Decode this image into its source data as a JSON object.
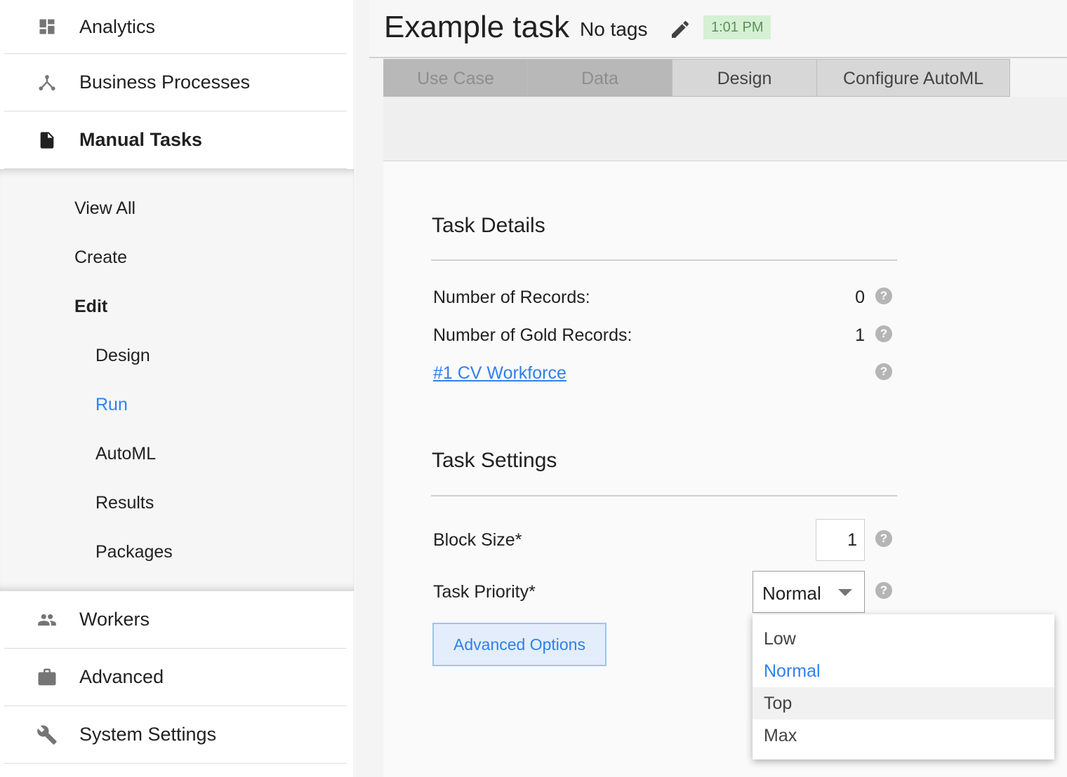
{
  "sidebar": {
    "items_top": [
      {
        "label": "Analytics",
        "icon": "dashboard-icon"
      },
      {
        "label": "Business Processes",
        "icon": "process-icon"
      },
      {
        "label": "Manual Tasks",
        "icon": "document-icon",
        "active": true
      }
    ],
    "sub_items": [
      {
        "label": "View All"
      },
      {
        "label": "Create"
      },
      {
        "label": "Edit",
        "bold": true
      },
      {
        "label": "Design"
      },
      {
        "label": "Run",
        "current": true
      },
      {
        "label": "AutoML"
      },
      {
        "label": "Results"
      },
      {
        "label": "Packages"
      }
    ],
    "items_bottom": [
      {
        "label": "Workers",
        "icon": "people-icon"
      },
      {
        "label": "Advanced",
        "icon": "briefcase-icon"
      },
      {
        "label": "System Settings",
        "icon": "wrench-icon"
      }
    ]
  },
  "header": {
    "title": "Example task",
    "tags": "No tags",
    "time": "1:01 PM"
  },
  "tabs": [
    {
      "label": "Use Case",
      "state": "disabled"
    },
    {
      "label": "Data",
      "state": "disabled"
    },
    {
      "label": "Design",
      "state": "enabled"
    },
    {
      "label": "Configure AutoML",
      "state": "enabled"
    }
  ],
  "task_details": {
    "title": "Task Details",
    "records_label": "Number of Records:",
    "records_value": "0",
    "gold_label": "Number of Gold Records:",
    "gold_value": "1",
    "workforce_link": "#1 CV Workforce"
  },
  "task_settings": {
    "title": "Task Settings",
    "block_size_label": "Block Size*",
    "block_size_value": "1",
    "priority_label": "Task Priority*",
    "priority_value": "Normal",
    "priority_options": [
      "Low",
      "Normal",
      "Top",
      "Max"
    ],
    "advanced_button": "Advanced Options"
  },
  "help_glyph": "?",
  "colors": {
    "accent": "#2f80ed",
    "time_badge_bg": "#d5f0d2",
    "time_badge_text": "#5e8f5a"
  }
}
